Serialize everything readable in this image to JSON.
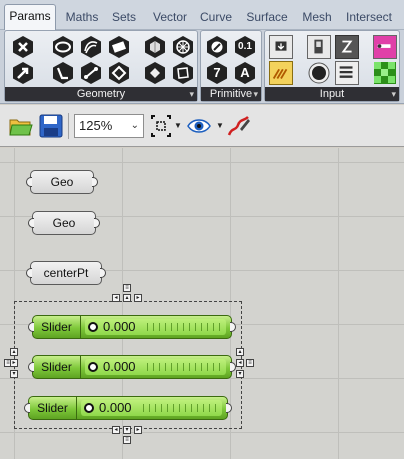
{
  "tabs": [
    {
      "label": "Params",
      "active": true
    },
    {
      "label": "Maths"
    },
    {
      "label": "Sets"
    },
    {
      "label": "Vector"
    },
    {
      "label": "Curve"
    },
    {
      "label": "Surface"
    },
    {
      "label": "Mesh"
    },
    {
      "label": "Intersect"
    }
  ],
  "ribbon": {
    "panels": [
      {
        "label": "Geometry"
      },
      {
        "label": "Primitive"
      },
      {
        "label": "Input"
      }
    ],
    "primitive_icons": [
      "0.1",
      "7",
      "A"
    ]
  },
  "toolbar": {
    "zoom": "125%",
    "icons": [
      "open-file-icon",
      "save-file-icon",
      "zoom-extents-icon",
      "eye-icon",
      "sketch-pen-icon"
    ]
  },
  "canvas": {
    "params": [
      {
        "label": "Geo"
      },
      {
        "label": "Geo"
      },
      {
        "label": "centerPt"
      }
    ],
    "sliders": [
      {
        "label": "Slider",
        "value": "0.000"
      },
      {
        "label": "Slider",
        "value": "0.000"
      },
      {
        "label": "Slider",
        "value": "0.000"
      }
    ]
  },
  "colors": {
    "slider_green": "#7ec83a",
    "panel_label_bg": "#2f2f34",
    "canvas_bg": "#d3d3cf"
  }
}
